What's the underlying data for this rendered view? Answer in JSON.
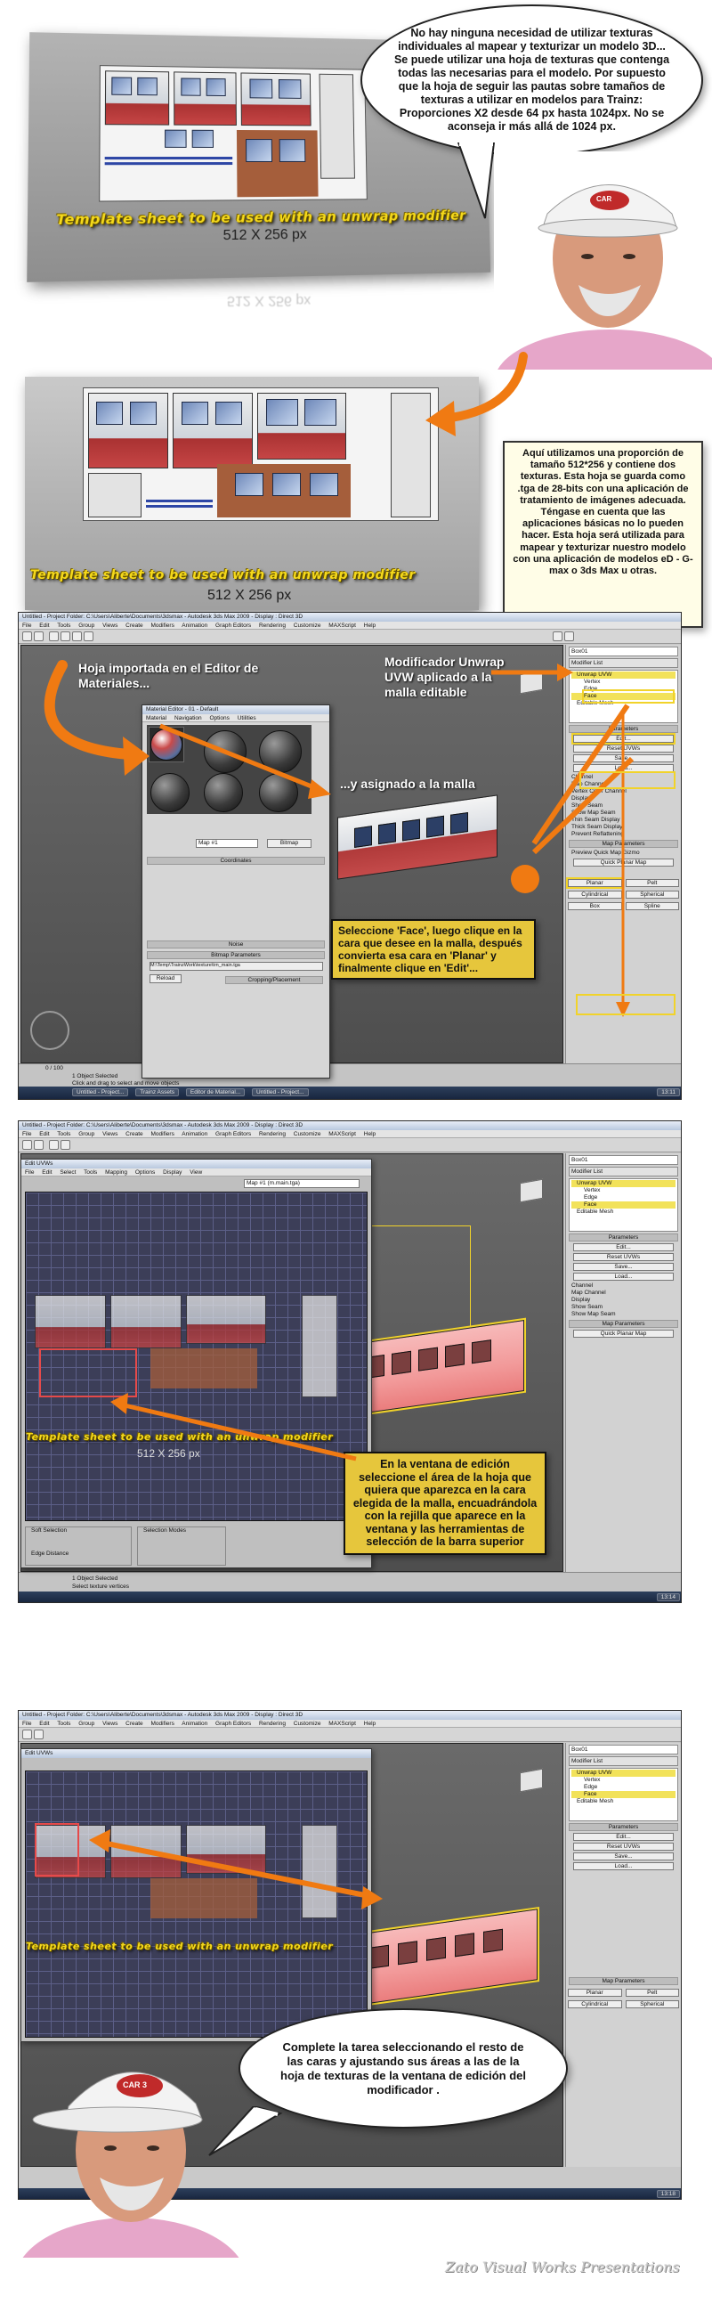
{
  "panel1": {
    "sheet_title": "Template sheet to be used with an unwrap modifier",
    "sheet_size": "512 X 256 px",
    "bubble_text": "No hay ninguna necesidad de utilizar texturas individuales al mapear y texturizar un modelo 3D... Se puede utilizar una hoja de texturas que contenga todas las necesarias para el modelo. Por supuesto que la hoja de seguir las pautas sobre tamaños de texturas a utilizar en modelos para Trainz: Proporciones X2 desde 64 px hasta 1024px. No se aconseja ir más allá de 1024 px.",
    "cap_logo": "CAR"
  },
  "panel2": {
    "sheet_title": "Template sheet to be used with an unwrap modifier",
    "sheet_size": "512 X 256 px",
    "note_text": "Aquí utilizamos una proporción de tamaño 512*256 y contiene dos texturas. Esta hoja se guarda como .tga de 28-bits con una aplicación de tratamiento de imágenes adecuada. Téngase en cuenta que las aplicaciones básicas no lo pueden hacer. Esta hoja será utilizada para mapear y texturizar nuestro modelo con una aplicación de modelos eD - G-max o 3ds Max u otras."
  },
  "shot1": {
    "title_bar": "Untitled - Project Folder: C:\\Users\\Aliberte\\Documents\\3dsmax - Autodesk 3ds Max 2009 - Display : Direct 3D",
    "menus": [
      "File",
      "Edit",
      "Tools",
      "Group",
      "Views",
      "Create",
      "Modifiers",
      "Animation",
      "Graph Editors",
      "Rendering",
      "Customize",
      "MAXScript",
      "Help"
    ],
    "label_imported": "Hoja importada en el Editor de Materiales...",
    "label_modifier": "Modificador Unwrap UVW aplicado a la malla editable",
    "label_assigned": "...y asignado a la malla",
    "callout": "Seleccione 'Face', luego clique en la cara que desee en la malla, después convierta esa cara en 'Planar' y finalmente clique en 'Edit'...",
    "mat_editor_title": "Material Editor - 01 - Default",
    "mat_menus": [
      "Material",
      "Navigation",
      "Options",
      "Utilities"
    ],
    "mat_name": "Map #1",
    "mat_type": "Bitmap",
    "mat_rollouts": [
      "Coordinates",
      "Noise",
      "Bitmap Parameters",
      "Cropping/Placement"
    ],
    "bitmap_path": "M:\\Temp\\TrainzWork\\texture\\trn_main.tga",
    "reload_label": "Reload",
    "object_name": "Box01",
    "modifier_list": "Modifier List",
    "stack": [
      "Unwrap UVW",
      "Vertex",
      "Edge",
      "Face",
      "Editable Mesh"
    ],
    "panel_items": [
      "Parameters",
      "Edit...",
      "Reset UVWs",
      "Save...",
      "Load...",
      "Channel",
      "Map Channel",
      "Vertex Color Channel",
      "Display",
      "Show Seam",
      "Show Map Seam",
      "Thin Seam Display",
      "Thick Seam Display",
      "Prevent Reflattening",
      "Map Parameters",
      "Preview Quick Map Gizmo",
      "Quick Planar Map",
      "Planar",
      "Pelt",
      "Cylindrical",
      "Spherical",
      "Box",
      "Spline"
    ],
    "status": [
      "1 Object Selected",
      "Click and drag to select and move objects"
    ],
    "timeline": "0 / 100",
    "taskbar": [
      "Untitled - Project...",
      "Trainz Assets",
      "Editor de Material...",
      "Untitled - Project..."
    ],
    "taskbar_clock": "13:11"
  },
  "shot2": {
    "title_bar": "Untitled - Project Folder: C:\\Users\\Aliberte\\Documents\\3dsmax - Autodesk 3ds Max 2009 - Display : Direct 3D",
    "uvw_title": "Edit UVWs",
    "uvw_menus": [
      "File",
      "Edit",
      "Select",
      "Tools",
      "Mapping",
      "Options",
      "Display",
      "View"
    ],
    "uvw_map_select": "Map #1 (m.main.tga)",
    "uvw_sheet_title": "Template sheet to be used with an unwrap modifier",
    "uvw_sheet_size": "512 X 256 px",
    "callout": "En la ventana de edición seleccione el área de la hoja que quiera que aparezca en la cara elegida de la malla, encuadrándola con la rejilla que aparece en la ventana y las herramientas de selección de la barra superior",
    "stack": [
      "Unwrap UVW",
      "Vertex",
      "Edge",
      "Face",
      "Editable Mesh"
    ],
    "status": [
      "1 Object Selected",
      "Select texture vertices"
    ],
    "soft_selection": "Soft Selection",
    "edge_distance": "Edge Distance",
    "selection_modes": "Selection Modes",
    "taskbar_clock": "13:14"
  },
  "shot3": {
    "title_bar": "Untitled - Project Folder: C:\\Users\\Aliberte\\Documents\\3dsmax - Autodesk 3ds Max 2009 - Display : Direct 3D",
    "uvw_title": "Edit UVWs",
    "uvw_sheet_title": "Template sheet to be used with an unwrap modifier",
    "bubble_text": "Complete la tarea seleccionando el resto de las caras y ajustando sus áreas a las de la hoja de texturas de la ventana de edición del modificador .",
    "stack": [
      "Unwrap UVW",
      "Vertex",
      "Edge",
      "Face",
      "Editable Mesh"
    ],
    "cap_logo": "CAR 3",
    "taskbar_clock": "13:18"
  },
  "footer": {
    "signature": "Zato Visual Works Presentations"
  },
  "colors": {
    "accent_orange": "#f07a12",
    "title_yellow": "#f5d91b",
    "callout_yellow": "#e6c63c",
    "selection_yellow": "#f1d32a"
  }
}
